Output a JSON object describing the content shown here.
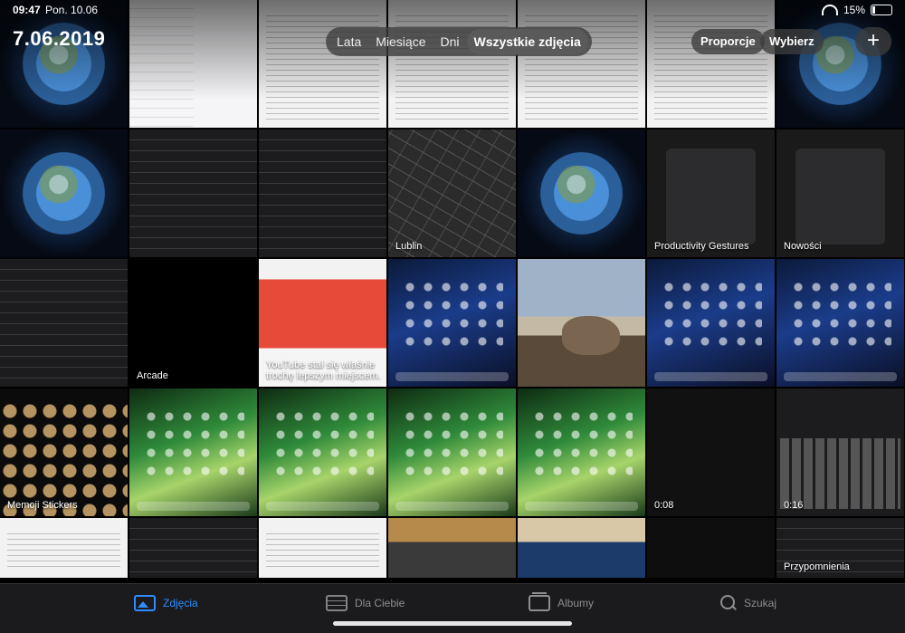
{
  "status_bar": {
    "time": "09:47",
    "date": "Pon. 10.06",
    "battery": "15%"
  },
  "header": {
    "date_title": "7.06.2019",
    "segments": [
      "Lata",
      "Miesiące",
      "Dni",
      "Wszystkie zdjęcia"
    ],
    "active_segment": "Wszystkie zdjęcia",
    "aspect_button": "Proporcje",
    "select_button": "Wybierz",
    "add_button": "+"
  },
  "grid": {
    "cells": [
      {
        "style": "t-earth",
        "label": ""
      },
      {
        "style": "t-settings-l",
        "label": ""
      },
      {
        "style": "t-doc",
        "label": ""
      },
      {
        "style": "t-doc",
        "label": ""
      },
      {
        "style": "t-doc",
        "label": ""
      },
      {
        "style": "t-doc",
        "label": ""
      },
      {
        "style": "t-earth",
        "label": ""
      },
      {
        "style": "t-earth",
        "label": ""
      },
      {
        "style": "t-settings-d",
        "label": ""
      },
      {
        "style": "t-settings-d",
        "label": ""
      },
      {
        "style": "t-map",
        "label": "Lublin"
      },
      {
        "style": "t-earth",
        "label": ""
      },
      {
        "style": "t-darkmodal",
        "label": "Productivity Gestures"
      },
      {
        "style": "t-darkmodal",
        "label": "Nowości"
      },
      {
        "style": "t-settings-d",
        "label": ""
      },
      {
        "style": "t-arcade",
        "label": "Arcade"
      },
      {
        "style": "t-yt",
        "label": "YouTube stał się właśnie trochę lepszym miejscem."
      },
      {
        "style": "t-ios-dark",
        "label": ""
      },
      {
        "style": "t-cat",
        "label": ""
      },
      {
        "style": "t-ios-dark",
        "label": ""
      },
      {
        "style": "t-ios-dark",
        "label": ""
      },
      {
        "style": "t-emoji",
        "label": "Memoji Stickers"
      },
      {
        "style": "t-ios-green",
        "label": ""
      },
      {
        "style": "t-ios-green",
        "label": ""
      },
      {
        "style": "t-ios-green",
        "label": ""
      },
      {
        "style": "t-ios-green",
        "label": ""
      },
      {
        "style": "t-dark",
        "label": "0:08"
      },
      {
        "style": "t-keyboard",
        "label": "0:16"
      },
      {
        "style": "t-doc",
        "label": ""
      },
      {
        "style": "t-settings-d",
        "label": ""
      },
      {
        "style": "t-doc",
        "label": ""
      },
      {
        "style": "t-room",
        "label": ""
      },
      {
        "style": "t-room2",
        "label": ""
      },
      {
        "style": "t-chat",
        "label": ""
      },
      {
        "style": "t-settings-d",
        "label": "Przypomnienia"
      }
    ]
  },
  "tabbar": {
    "tabs": [
      {
        "label": "Zdjęcia",
        "icon": "photos-icon",
        "active": true
      },
      {
        "label": "Dla Ciebie",
        "icon": "for-you-icon",
        "active": false
      },
      {
        "label": "Albumy",
        "icon": "albums-icon",
        "active": false
      },
      {
        "label": "Szukaj",
        "icon": "search-icon",
        "active": false
      }
    ]
  }
}
